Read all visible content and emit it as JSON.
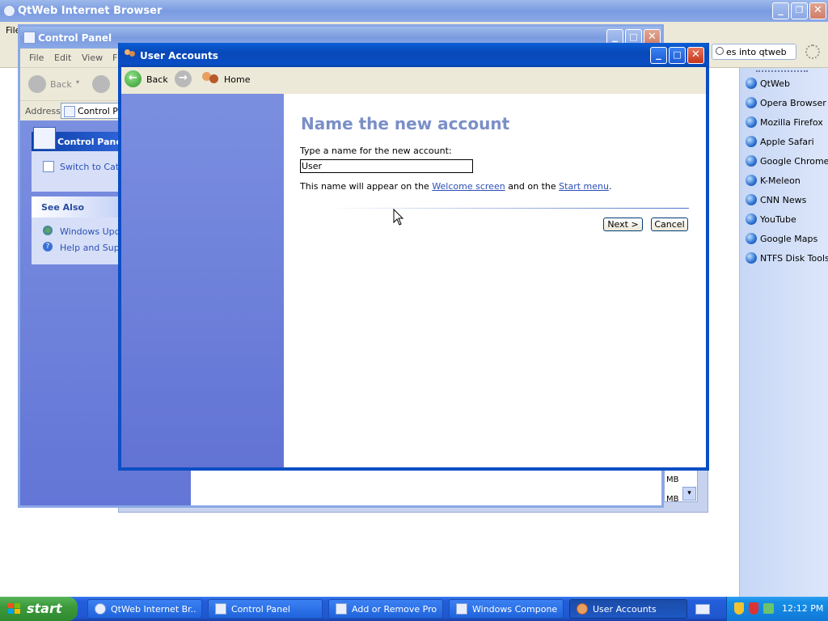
{
  "browser": {
    "title": "QtWeb Internet Browser",
    "menu_file": "File",
    "search_text": "es into qtweb",
    "sidebar_items": [
      "QtWeb",
      "Opera Browser",
      "Mozilla Firefox",
      "Apple Safari",
      "Google Chrome",
      "K-Meleon",
      "CNN News",
      "YouTube",
      "Google Maps",
      "NTFS Disk Tools"
    ]
  },
  "control_panel": {
    "title": "Control Panel",
    "menu": [
      "File",
      "Edit",
      "View",
      "F"
    ],
    "back_label": "Back",
    "address_label": "Address",
    "address_value": "Control Pa",
    "task_header": "Control Panel",
    "switch_link": "Switch to Categ",
    "see_also_header": "See Also",
    "see_also_items": [
      "Windows Upda",
      "Help and Suppo"
    ],
    "list_fragment_1": "MB",
    "list_fragment_2": "MB"
  },
  "user_accounts": {
    "title": "User Accounts",
    "back_label": "Back",
    "home_label": "Home",
    "heading": "Name the new account",
    "prompt": "Type a name for the new account:",
    "name_value": "User",
    "note_prefix": "This name will appear on the",
    "welcome_link": "Welcome screen",
    "note_middle": "and on the",
    "start_link": "Start menu",
    "note_suffix": ".",
    "next_label": "Next >",
    "cancel_label": "Cancel"
  },
  "taskbar": {
    "start_label": "start",
    "tasks": [
      "QtWeb Internet Br...",
      "Control Panel",
      "Add or Remove Pro...",
      "Windows Compone...",
      "User Accounts"
    ],
    "clock": "12:12 PM"
  },
  "colors": {
    "xp_blue": "#0a5fd6",
    "task_pane": "#7b8fe0",
    "taskbar": "#245edb",
    "start_green": "#3c9a3c"
  }
}
